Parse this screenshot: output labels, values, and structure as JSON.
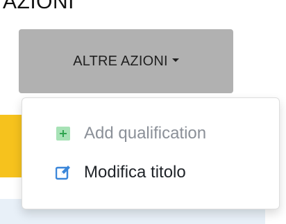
{
  "header": {
    "partial_title": "AZIONI"
  },
  "button": {
    "label": "ALTRE AZIONI"
  },
  "menu": {
    "items": [
      {
        "label": "Add qualification",
        "icon": "plus-square-icon",
        "state": "disabled",
        "icon_color": "#2ea44f"
      },
      {
        "label": "Modifica titolo",
        "icon": "pencil-square-icon",
        "state": "enabled",
        "icon_color": "#3a86d9"
      }
    ]
  },
  "colors": {
    "button_bg": "#b1b1b1",
    "accent_yellow": "#f6c21d",
    "band_blue": "#e8f0f8"
  }
}
